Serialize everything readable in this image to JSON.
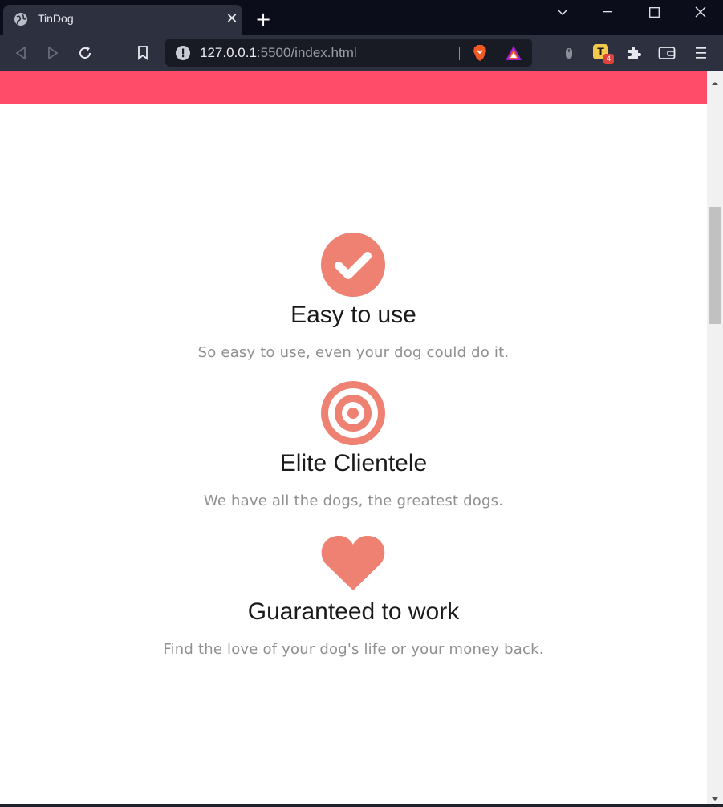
{
  "browser": {
    "tab": {
      "title": "TinDog",
      "close_symbol": "✕"
    },
    "new_tab_symbol": "+",
    "address": {
      "host": "127.0.0.1",
      "path": ":5500/index.html"
    },
    "extension_badge": {
      "letter": "T",
      "count": "4"
    }
  },
  "colors": {
    "hero": "#ff4c68",
    "icon": "#ef8172",
    "title": "#1a1a1a",
    "description": "#8f8f8f"
  },
  "features": [
    {
      "icon": "check-circle-icon",
      "title": "Easy to use",
      "description": "So easy to use, even your dog could do it."
    },
    {
      "icon": "bullseye-icon",
      "title": "Elite Clientele",
      "description": "We have all the dogs, the greatest dogs."
    },
    {
      "icon": "heart-icon",
      "title": "Guaranteed to work",
      "description": "Find the love of your dog's life or your money back."
    }
  ]
}
